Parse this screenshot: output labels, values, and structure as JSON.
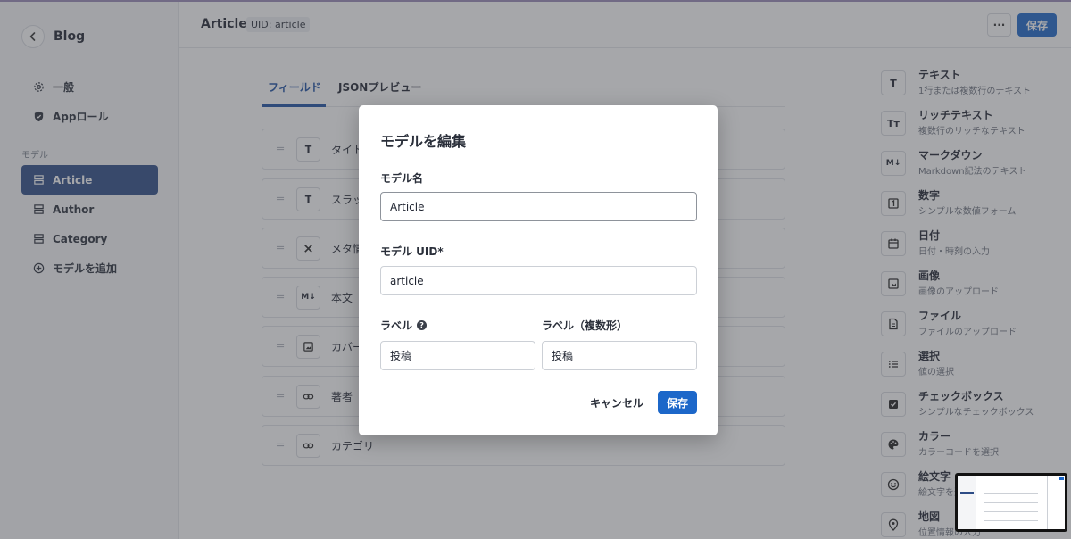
{
  "sidebar": {
    "back_label": "Blog",
    "items": [
      {
        "label": "一般"
      },
      {
        "label": "Appロール"
      }
    ],
    "section_label": "モデル",
    "models": [
      {
        "label": "Article"
      },
      {
        "label": "Author"
      },
      {
        "label": "Category"
      }
    ],
    "add_model_label": "モデルを追加"
  },
  "header": {
    "title": "Article",
    "uid_badge": "UID: article",
    "more_label": "···",
    "save_label": "保存"
  },
  "main": {
    "tabs": [
      {
        "label": "フィールド",
        "active": true
      },
      {
        "label": "JSONプレビュー",
        "active": false
      }
    ],
    "fields": [
      {
        "icon": "text-icon",
        "label": "タイトル"
      },
      {
        "icon": "text-icon",
        "label": "スラッグ"
      },
      {
        "icon": "tools-icon",
        "label": "メタ情報"
      },
      {
        "icon": "markdown-icon",
        "label": "本文"
      },
      {
        "icon": "image-icon",
        "label": "カバー画像"
      },
      {
        "icon": "link-icon",
        "label": "著者"
      },
      {
        "icon": "link-icon",
        "label": "カテゴリ"
      }
    ]
  },
  "field_types": [
    {
      "icon": "text-icon",
      "glyph": "T",
      "name": "テキスト",
      "desc": "1行または複数行のテキスト"
    },
    {
      "icon": "rich-text-icon",
      "glyph": "Tт",
      "name": "リッチテキスト",
      "desc": "複数行のリッチなテキスト"
    },
    {
      "icon": "markdown-icon",
      "glyph": "M↓",
      "name": "マークダウン",
      "desc": "Markdown記法のテキスト"
    },
    {
      "icon": "number-icon",
      "glyph": "1",
      "name": "数字",
      "desc": "シンプルな数値フォーム"
    },
    {
      "icon": "calendar-icon",
      "glyph": "",
      "name": "日付",
      "desc": "日付・時刻の入力"
    },
    {
      "icon": "image-icon",
      "glyph": "",
      "name": "画像",
      "desc": "画像のアップロード"
    },
    {
      "icon": "file-icon",
      "glyph": "",
      "name": "ファイル",
      "desc": "ファイルのアップロード"
    },
    {
      "icon": "list-icon",
      "glyph": "",
      "name": "選択",
      "desc": "値の選択"
    },
    {
      "icon": "checkbox-icon",
      "glyph": "",
      "name": "チェックボックス",
      "desc": "シンプルなチェックボックス"
    },
    {
      "icon": "palette-icon",
      "glyph": "",
      "name": "カラー",
      "desc": "カラーコードを選択"
    },
    {
      "icon": "emoji-icon",
      "glyph": "",
      "name": "絵文字",
      "desc": "絵文字を選択"
    },
    {
      "icon": "map-pin-icon",
      "glyph": "",
      "name": "地図",
      "desc": "位置情報の入力"
    }
  ],
  "modal": {
    "title": "モデルを編集",
    "model_name_label": "モデル名",
    "model_name_value": "Article",
    "model_uid_label": "モデル UID*",
    "model_uid_value": "article",
    "label_label": "ラベル",
    "label_value": "投稿",
    "label_plural_label": "ラベル（複数形）",
    "label_plural_value": "投稿",
    "cancel_label": "キャンセル",
    "save_label": "保存"
  },
  "colors": {
    "accent": "#1c67c9",
    "sidebar_active": "#2d4c86",
    "tab_active": "#1c4fa3"
  }
}
